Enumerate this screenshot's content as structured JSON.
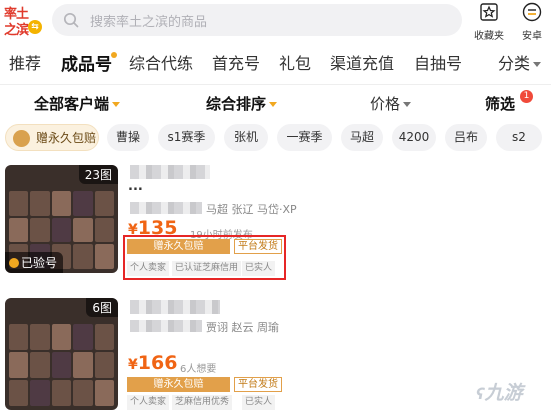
{
  "header": {
    "logo_line1": "率土",
    "logo_line2": "之滨",
    "search_placeholder": "搜索率土之滨的商品",
    "favorites_label": "收藏夹",
    "android_label": "安卓"
  },
  "tabs": [
    "推荐",
    "成品号",
    "综合代练",
    "首充号",
    "礼包",
    "渠道充值",
    "自抽号",
    "分类"
  ],
  "filters": {
    "client": "全部客户端",
    "sort": "综合排序",
    "price": "价格",
    "filter": "筛选",
    "filter_badge": "1"
  },
  "chips": [
    "赠永久包赔",
    "曹操",
    "s1赛季",
    "张机",
    "一赛季",
    "马超",
    "4200",
    "吕布",
    "s2"
  ],
  "listings": [
    {
      "image_count": "23图",
      "verified": "已验号",
      "title_ellipsis": "...",
      "heroes": "马超 张辽 马岱·XP",
      "currency": "¥",
      "price": "135",
      "meta": "19小时前发布",
      "tag_primary": "赠永久包赔",
      "tag_secondary": "平台发货",
      "seller_tags": [
        "个人卖家",
        "已认证芝麻信用",
        "已实人"
      ]
    },
    {
      "image_count": "6图",
      "heroes": "贾诩 赵云 周瑜",
      "currency": "¥",
      "price": "166",
      "meta": "6人想要",
      "tag_primary": "赠永久包赔",
      "tag_secondary": "平台发货",
      "seller_tags": [
        "个人卖家",
        "芝麻信用优秀",
        "已实人"
      ]
    }
  ],
  "watermark": "九游",
  "colors": {
    "accent": "#f1a820",
    "price": "#f06414",
    "highlight_box": "#e62626"
  }
}
